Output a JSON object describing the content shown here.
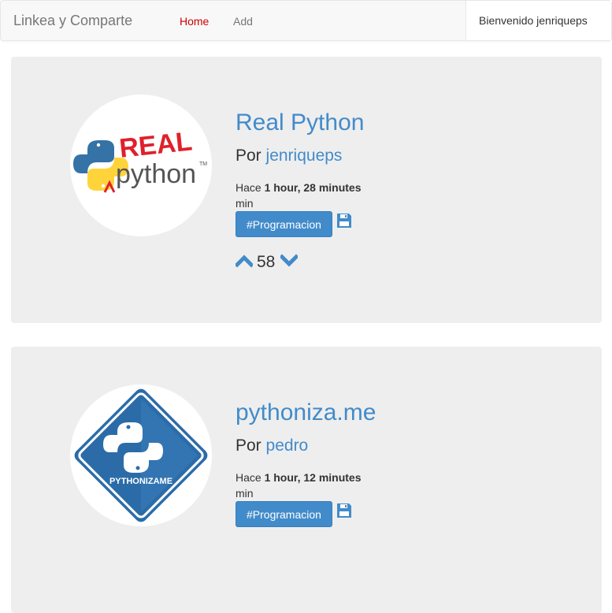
{
  "navbar": {
    "brand": "Linkea y Comparte",
    "links": [
      {
        "label": "Home",
        "active": true
      },
      {
        "label": "Add",
        "active": false
      }
    ],
    "welcome": "Bienvenido jenriqueps"
  },
  "colors": {
    "accent": "#428bca",
    "active_nav": "#cc0000",
    "card_bg": "#eeeeee"
  },
  "links": [
    {
      "title": "Real Python",
      "by_prefix": "Por",
      "author": "jenriqueps",
      "time_prefix": "Hace",
      "time_value": "1 hour, 28 minutes",
      "time_suffix": "min",
      "tag": "#Programacion",
      "votes": "58",
      "logo_icon": "real-python-logo",
      "save_icon": "floppy-disk-icon",
      "up_icon": "chevron-up-icon",
      "down_icon": "chevron-down-icon"
    },
    {
      "title": "pythoniza.me",
      "by_prefix": "Por",
      "author": "pedro",
      "time_prefix": "Hace",
      "time_value": "1 hour, 12 minutes",
      "time_suffix": "min",
      "tag": "#Programacion",
      "logo_icon": "pythonizame-logo",
      "logo_text": "PYTHONIZAME",
      "save_icon": "floppy-disk-icon"
    }
  ]
}
